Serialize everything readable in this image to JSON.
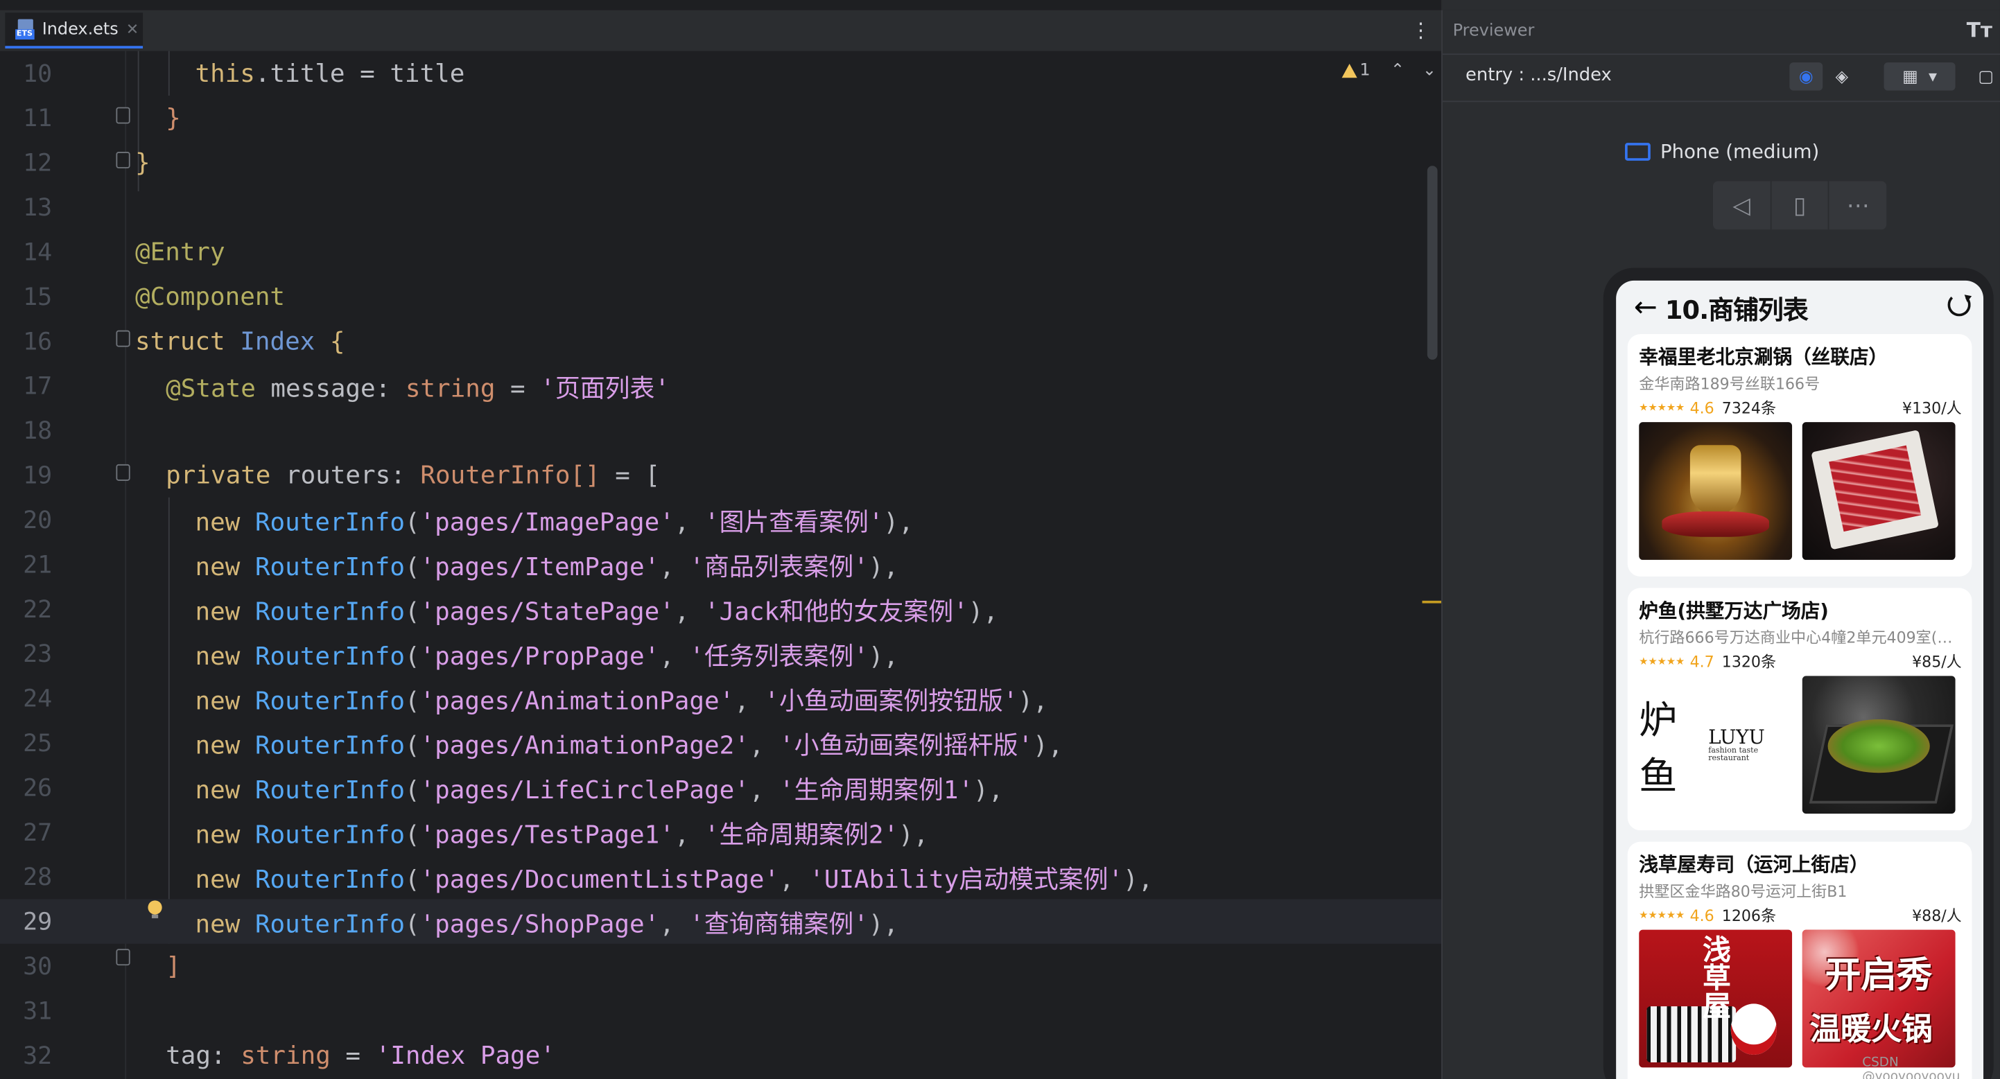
{
  "editor": {
    "tab": {
      "title": "Index.ets",
      "icon": "ets-file-icon"
    },
    "inspection": {
      "warnings": "1"
    },
    "lines": [
      {
        "n": "10"
      },
      {
        "n": "11"
      },
      {
        "n": "12"
      },
      {
        "n": "13"
      },
      {
        "n": "14"
      },
      {
        "n": "15"
      },
      {
        "n": "16"
      },
      {
        "n": "17"
      },
      {
        "n": "18"
      },
      {
        "n": "19"
      },
      {
        "n": "20"
      },
      {
        "n": "21"
      },
      {
        "n": "22"
      },
      {
        "n": "23"
      },
      {
        "n": "24"
      },
      {
        "n": "25"
      },
      {
        "n": "26"
      },
      {
        "n": "27"
      },
      {
        "n": "28"
      },
      {
        "n": "29"
      },
      {
        "n": "30"
      },
      {
        "n": "31"
      },
      {
        "n": "32"
      }
    ],
    "code": {
      "l10": {
        "this_kw": "this",
        "rest": ".title = title"
      },
      "l11": "}",
      "l12": "}",
      "l14": "@Entry",
      "l15": "@Component",
      "l16": {
        "kw": "struct",
        "name": "Index",
        "brace": "{"
      },
      "l17": {
        "dec": "@State",
        "field": " message: ",
        "type": "string",
        "eq": " = ",
        "val": "'页面列表'"
      },
      "l19": {
        "kw": "private",
        "field": " routers: ",
        "type": "RouterInfo[]",
        "eq": " = ["
      },
      "routes": [
        {
          "path": "'pages/ImagePage'",
          "label": "'图片查看案例'"
        },
        {
          "path": "'pages/ItemPage'",
          "label": "'商品列表案例'"
        },
        {
          "path": "'pages/StatePage'",
          "label": "'Jack和他的女友案例'"
        },
        {
          "path": "'pages/PropPage'",
          "label": "'任务列表案例'"
        },
        {
          "path": "'pages/AnimationPage'",
          "label": "'小鱼动画案例按钮版'"
        },
        {
          "path": "'pages/AnimationPage2'",
          "label": "'小鱼动画案例摇杆版'"
        },
        {
          "path": "'pages/LifeCirclePage'",
          "label": "'生命周期案例1'"
        },
        {
          "path": "'pages/TestPage1'",
          "label": "'生命周期案例2'"
        },
        {
          "path": "'pages/DocumentListPage'",
          "label": "'UIAbility启动模式案例'"
        },
        {
          "path": "'pages/ShopPage'",
          "label": "'查询商铺案例'"
        }
      ],
      "new_kw": "new",
      "ctor": "RouterInfo",
      "l30": "]",
      "l32": {
        "field": "tag: ",
        "type": "string",
        "eq": " = ",
        "val": "'Index Page'"
      }
    },
    "current_line": "29"
  },
  "previewer": {
    "title": "Previewer",
    "tt_icon": "Tт",
    "entry": "entry : ...s/Index",
    "device": "Phone (medium)",
    "app": {
      "title": "10.商铺列表",
      "shops": [
        {
          "name": "幸福里老北京涮锅（丝联店）",
          "address": "金华南路189号丝联166号",
          "stars": "★★★★★",
          "score": "4.6",
          "count": "7324条",
          "price": "¥130/人"
        },
        {
          "name": "炉鱼(拱墅万达广场店)",
          "address": "杭行路666号万达商业中心4幢2单元409室(铺...",
          "stars": "★★★★★",
          "score": "4.7",
          "count": "1320条",
          "price": "¥85/人",
          "logo_cn": "炉鱼",
          "logo_en": "LUYU",
          "logo_sub": "fashion taste restaurant"
        },
        {
          "name": "浅草屋寿司（运河上街店）",
          "address": "拱墅区金华路80号运河上街B1",
          "stars": "★★★★★",
          "score": "4.6",
          "count": "1206条",
          "price": "¥88/人",
          "sign_a": "浅草屋",
          "sign_b1": "开启秀",
          "sign_b2": "温暖火锅"
        }
      ]
    }
  },
  "watermark": "CSDN @yooyooyooyu",
  "colors": {
    "accent": "#3574f0",
    "editor_bg": "#1e1f22",
    "panel_bg": "#2b2d30",
    "string": "#d99ee8",
    "keyword": "#cf8e6d",
    "star": "#f1a41c"
  }
}
